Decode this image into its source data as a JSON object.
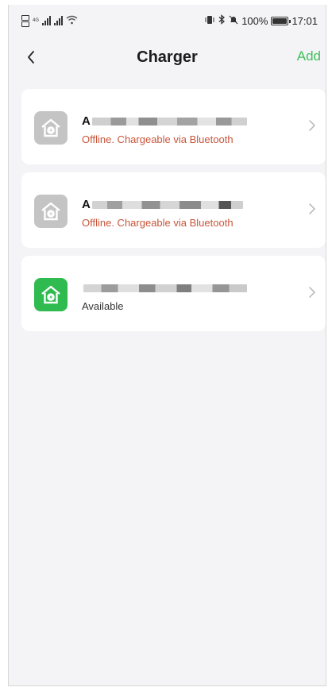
{
  "status_bar": {
    "battery": "100%",
    "time": "17:01",
    "icons": [
      "sim-card-icon",
      "signal-icon",
      "wifi-icon",
      "vibrate-icon",
      "bluetooth-icon",
      "do-not-disturb-icon",
      "battery-icon"
    ]
  },
  "header": {
    "title": "Charger",
    "add_label": "Add",
    "back_icon": "chevron-left-icon"
  },
  "colors": {
    "accent": "#3fbf5b",
    "offline_text": "#c8553a",
    "offline_icon_bg": "#c4c4c4",
    "available_icon_bg": "#2fbb4f"
  },
  "chargers": [
    {
      "name_visible": "A",
      "status": "Offline. Chargeable via Bluetooth",
      "state": "offline",
      "icon": "charger-home-icon"
    },
    {
      "name_visible": "A",
      "status": "Offline. Chargeable via Bluetooth",
      "state": "offline",
      "icon": "charger-home-icon"
    },
    {
      "name_visible": "",
      "status": "Available",
      "state": "available",
      "icon": "charger-home-icon"
    }
  ]
}
